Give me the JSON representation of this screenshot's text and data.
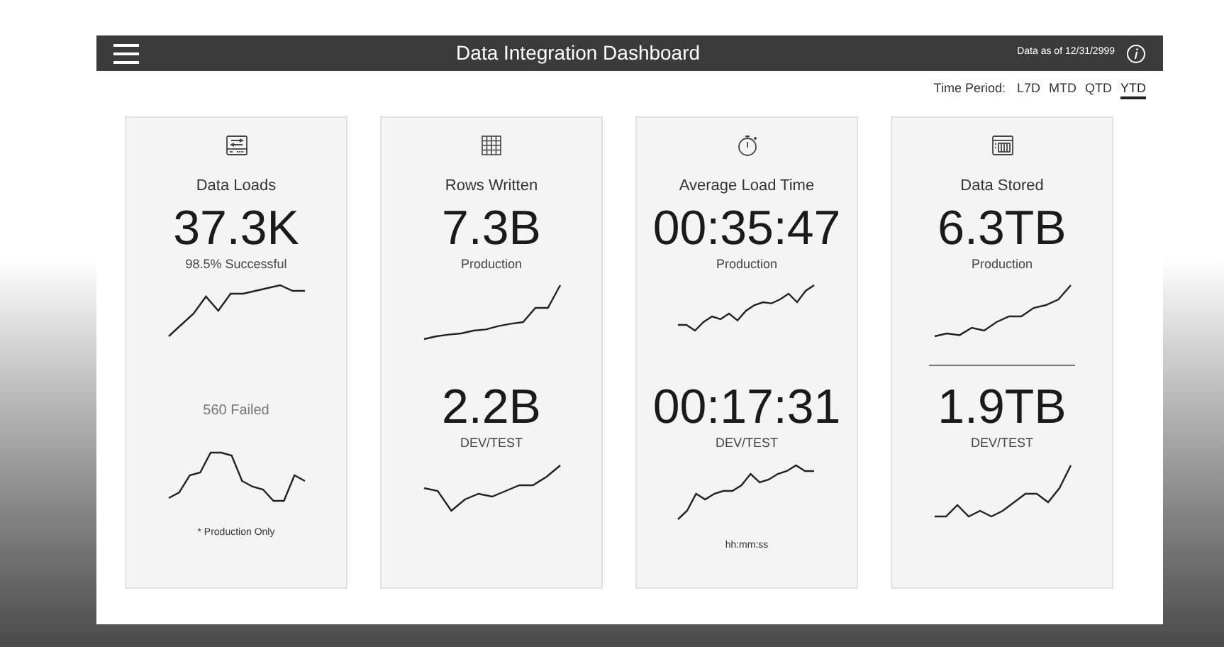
{
  "header": {
    "title": "Data Integration Dashboard",
    "data_as_of": "Data as of 12/31/2999"
  },
  "time_period": {
    "label": "Time Period:",
    "options": [
      {
        "label": "L7D",
        "selected": false
      },
      {
        "label": "MTD",
        "selected": false
      },
      {
        "label": "QTD",
        "selected": false
      },
      {
        "label": "YTD",
        "selected": true
      }
    ]
  },
  "cards": [
    {
      "kind": "drive",
      "title": "Data Loads",
      "divider": false,
      "sections": [
        {
          "kind": "metric",
          "value": "37.3K",
          "caption": "98.5% Successful"
        },
        {
          "kind": "note",
          "text": "560 Failed"
        }
      ],
      "footnote": "* Production Only"
    },
    {
      "kind": "grid",
      "title": "Rows Written",
      "divider": false,
      "sections": [
        {
          "kind": "metric",
          "value": "7.3B",
          "caption": "Production"
        },
        {
          "kind": "metric",
          "value": "2.2B",
          "caption": "DEV/TEST"
        }
      ]
    },
    {
      "kind": "stopwatch",
      "title": "Average Load Time",
      "divider": false,
      "sections": [
        {
          "kind": "metric",
          "value": "00:35:47",
          "caption": "Production"
        },
        {
          "kind": "metric",
          "value": "00:17:31",
          "caption": "DEV/TEST"
        }
      ],
      "footnote": "hh:mm:ss"
    },
    {
      "kind": "storage",
      "title": "Data Stored",
      "divider": true,
      "sections": [
        {
          "kind": "metric",
          "value": "6.3TB",
          "caption": "Production"
        },
        {
          "kind": "metric",
          "value": "1.9TB",
          "caption": "DEV/TEST"
        }
      ]
    }
  ]
}
